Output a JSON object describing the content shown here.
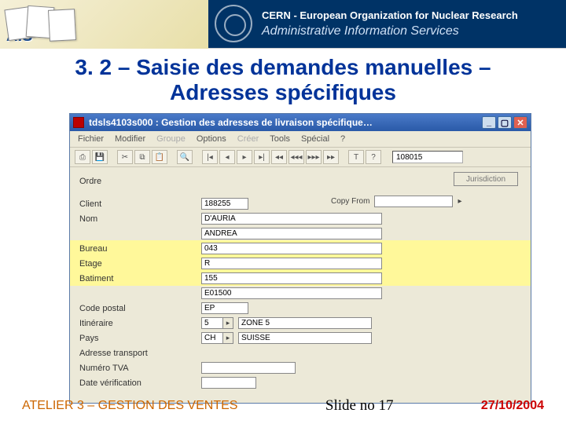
{
  "banner": {
    "ais_label": "AIS",
    "cern_line1": "CERN - European Organization for Nuclear Research",
    "cern_line2": "Administrative Information Services"
  },
  "slide_title": "3. 2 – Saisie des demandes manuelles – Adresses spécifiques",
  "window": {
    "title": "tdsls4103s000 : Gestion des adresses de livraison spécifique…",
    "menu": {
      "fichier": "Fichier",
      "modifier": "Modifier",
      "groupe": "Groupe",
      "options": "Options",
      "creer": "Créer",
      "tools": "Tools",
      "special": "Spécial",
      "help": "?"
    },
    "status_field": "108015",
    "jurisdiction_btn": "Jurisdiction",
    "copy_from_label": "Copy From",
    "fields": {
      "ordre": {
        "label": "Ordre",
        "value": ""
      },
      "client": {
        "label": "Client",
        "value": "188255"
      },
      "nom": {
        "label": "Nom",
        "value": "D'AURIA"
      },
      "prenom": {
        "label": "",
        "value": "ANDREA"
      },
      "bureau": {
        "label": "Bureau",
        "value": "043"
      },
      "etage": {
        "label": "Etage",
        "value": "R"
      },
      "batiment": {
        "label": "Batiment",
        "value": "155"
      },
      "adresse": {
        "label": "",
        "value": "E01500"
      },
      "code_postal": {
        "label": "Code postal",
        "value": "EP"
      },
      "itineraire": {
        "label": "Itinéraire",
        "value_code": "5",
        "value_text": "ZONE 5"
      },
      "pays": {
        "label": "Pays",
        "value_code": "CH",
        "value_text": "SUISSE"
      },
      "adresse_transport": {
        "label": "Adresse transport",
        "value": ""
      },
      "numero_tva": {
        "label": "Numéro TVA",
        "value": ""
      },
      "date_verification": {
        "label": "Date vérification",
        "value": ""
      }
    }
  },
  "footer": {
    "left": "ATELIER 3 – GESTION DES VENTES",
    "mid": "Slide no 17",
    "right": "27/10/2004"
  }
}
